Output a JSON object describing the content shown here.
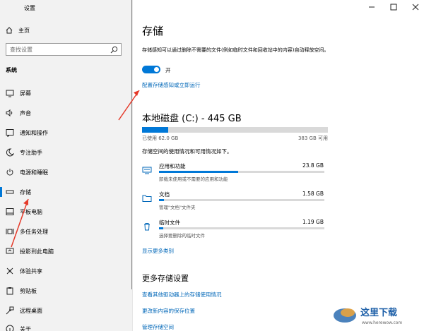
{
  "window": {
    "title": "设置",
    "controls": [
      "minimize-icon",
      "maximize-icon",
      "close-icon"
    ]
  },
  "sidebar": {
    "home_label": "主页",
    "search_placeholder": "查找设置",
    "section_title": "系统",
    "items": [
      {
        "label": "屏幕",
        "icon": "monitor-icon"
      },
      {
        "label": "声音",
        "icon": "speaker-icon"
      },
      {
        "label": "通知和操作",
        "icon": "notification-icon"
      },
      {
        "label": "专注助手",
        "icon": "moon-icon"
      },
      {
        "label": "电源和睡眠",
        "icon": "power-icon"
      },
      {
        "label": "存储",
        "icon": "storage-icon",
        "active": true
      },
      {
        "label": "平板电脑",
        "icon": "tablet-icon"
      },
      {
        "label": "多任务处理",
        "icon": "multitask-icon"
      },
      {
        "label": "投影到此电脑",
        "icon": "project-icon"
      },
      {
        "label": "体验共享",
        "icon": "share-icon"
      },
      {
        "label": "剪贴板",
        "icon": "clipboard-icon"
      },
      {
        "label": "远程桌面",
        "icon": "remote-desktop-icon"
      },
      {
        "label": "关于",
        "icon": "info-icon"
      }
    ]
  },
  "storage": {
    "title": "存储",
    "description": "存储感知可以通过删除不需要的文件(例如临时文件和回收站中的内容)自动释放空间。",
    "toggle_state": "开",
    "toggle_on": true,
    "configure_link": "配置存储感知或立即运行"
  },
  "disk": {
    "title": "本地磁盘 (C:) - 445 GB",
    "used_label": "已使用 62.0 GB",
    "available_label": "383 GB 可用",
    "used_fraction": 0.139,
    "usage_description": "存储空间的使用情况和可用情况如下。",
    "categories": [
      {
        "name": "应用和功能",
        "size": "23.8 GB",
        "sub": "卸载未使用或不需要的应用和功能",
        "fraction": 0.48,
        "icon": "apps-icon"
      },
      {
        "name": "文档",
        "size": "1.58 GB",
        "sub": "管理\"文档\"文件夹",
        "fraction": 0.03,
        "icon": "folder-icon"
      },
      {
        "name": "临时文件",
        "size": "1.19 GB",
        "sub": "选择要删除的临时文件",
        "fraction": 0.025,
        "icon": "trash-icon"
      }
    ],
    "show_more_link": "显示更多类别"
  },
  "more_settings": {
    "title": "更多存储设置",
    "links": [
      "查看其他驱动器上的存储使用情况",
      "更改新内容的保存位置",
      "管理存储空间"
    ]
  },
  "colors": {
    "accent": "#0078d7",
    "link": "#0067b8",
    "annotation_arrow": "#e53a2a"
  },
  "watermark": {
    "text": "这里下载",
    "url_text": "www.herewow.com"
  }
}
